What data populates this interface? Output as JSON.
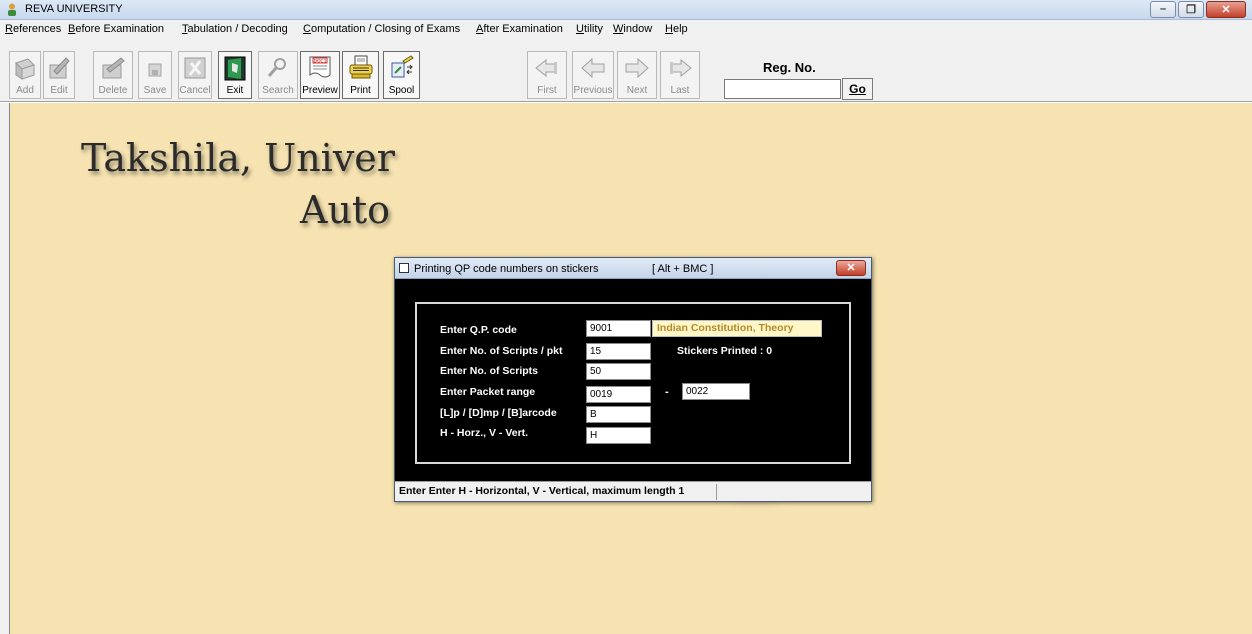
{
  "window": {
    "title": "REVA UNIVERSITY",
    "controls": {
      "minimize": "–",
      "restore": "❐",
      "close": "✕"
    }
  },
  "menu": [
    {
      "label": "References",
      "mnemonic": "R"
    },
    {
      "label": "Before Examination",
      "mnemonic": "B"
    },
    {
      "label": "Tabulation / Decoding",
      "mnemonic": "T"
    },
    {
      "label": "Computation / Closing of Exams",
      "mnemonic": "C"
    },
    {
      "label": "After Examination",
      "mnemonic": "A"
    },
    {
      "label": "Utility",
      "mnemonic": "U"
    },
    {
      "label": "Window",
      "mnemonic": "W"
    },
    {
      "label": "Help",
      "mnemonic": "H"
    }
  ],
  "toolbar": {
    "buttons": [
      {
        "label": "Add",
        "icon": "add-icon",
        "enabled": false
      },
      {
        "label": "Edit",
        "icon": "edit-icon",
        "enabled": false
      },
      {
        "label": "Delete",
        "icon": "delete-icon",
        "enabled": false
      },
      {
        "label": "Save",
        "icon": "save-icon",
        "enabled": false
      },
      {
        "label": "Cancel",
        "icon": "cancel-icon",
        "enabled": false
      },
      {
        "label": "Exit",
        "icon": "exit-door-icon",
        "enabled": true
      },
      {
        "label": "Search",
        "icon": "search-icon",
        "enabled": false
      },
      {
        "label": "Preview",
        "icon": "preview-doc-icon",
        "enabled": true
      },
      {
        "label": "Print",
        "icon": "printer-icon",
        "enabled": true
      },
      {
        "label": "Spool",
        "icon": "spool-icon",
        "enabled": true
      },
      {
        "label": "First",
        "icon": "first-arrow-icon",
        "enabled": false
      },
      {
        "label": "Previous",
        "icon": "previous-arrow-icon",
        "enabled": false
      },
      {
        "label": "Next",
        "icon": "next-arrow-icon",
        "enabled": false
      },
      {
        "label": "Last",
        "icon": "last-arrow-icon",
        "enabled": false
      }
    ],
    "reg_no_label": "Reg. No.",
    "reg_no_value": "",
    "go_label": "Go"
  },
  "background": {
    "line1": "Takshila, Univer",
    "line2": "Auto"
  },
  "dialog": {
    "title": "Printing QP code numbers on stickers",
    "shortcut": "[ Alt + BMC ]",
    "close": "✕",
    "fields": {
      "qp_code_label": "Enter Q.P. code",
      "qp_code_value": "9001",
      "qp_description": "Indian Constitution, Theory",
      "scripts_per_pkt_label": "Enter No. of Scripts / pkt",
      "scripts_per_pkt_value": "15",
      "stickers_printed": "Stickers Printed : 0",
      "scripts_label": "Enter No. of Scripts",
      "scripts_value": "50",
      "packet_range_label": "Enter Packet range",
      "packet_from": "0019",
      "packet_sep": "-",
      "packet_to": "0022",
      "lp_dmp_label": "[L]p / [D]mp / [B]arcode",
      "lp_dmp_value": "B",
      "orientation_label": "H - Horz., V - Vert.",
      "orientation_value": "H"
    },
    "status": "Enter Enter H - Horizontal, V - Vertical, maximum length 1"
  }
}
